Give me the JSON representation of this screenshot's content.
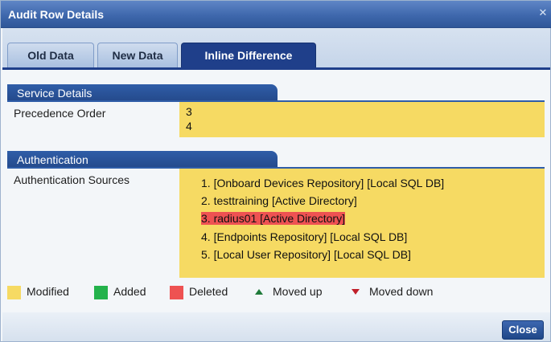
{
  "window": {
    "title": "Audit Row Details"
  },
  "tabs": [
    {
      "label": "Old Data",
      "state": "inactive"
    },
    {
      "label": "New Data",
      "state": "inactive"
    },
    {
      "label": "Inline Difference",
      "state": "active"
    }
  ],
  "service_details": {
    "header": "Service Details",
    "precedence_label": "Precedence Order",
    "precedence_values": [
      "3",
      "4"
    ]
  },
  "authentication": {
    "header": "Authentication",
    "sources_label": "Authentication Sources",
    "sources": [
      {
        "text": "1.  [Onboard Devices Repository] [Local SQL DB]",
        "status": "modified"
      },
      {
        "text": "2.  testtraining [Active Directory]",
        "status": "modified"
      },
      {
        "text": "3.  radius01 [Active Directory]",
        "status": "deleted"
      },
      {
        "text": "4.  [Endpoints Repository] [Local SQL DB]",
        "status": "modified"
      },
      {
        "text": "5.  [Local User Repository] [Local SQL DB]",
        "status": "modified"
      }
    ]
  },
  "legend": {
    "modified": "Modified",
    "added": "Added",
    "deleted": "Deleted",
    "moved_up": "Moved up",
    "moved_down": "Moved down"
  },
  "colors": {
    "modified": "#f6da63",
    "added": "#23b24b",
    "deleted": "#ee5252",
    "moved_up": "#1f7a3a",
    "moved_down": "#c0202a"
  },
  "footer": {
    "close_label": "Close"
  }
}
